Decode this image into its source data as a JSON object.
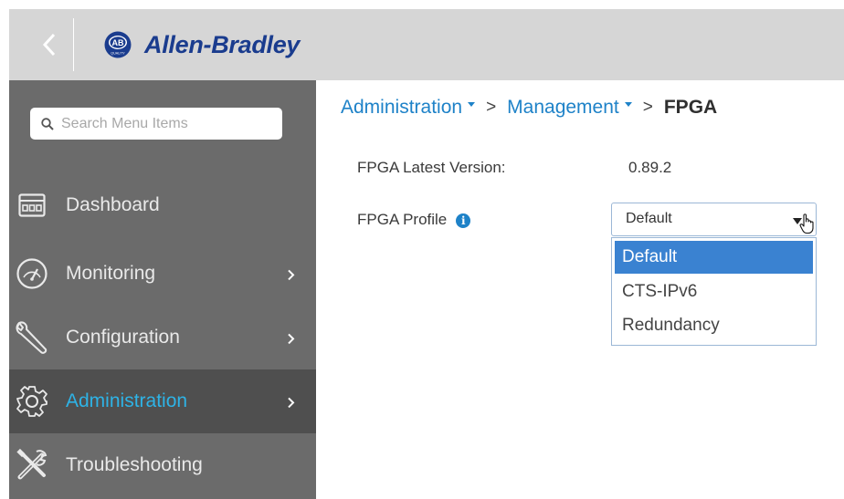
{
  "header": {
    "back_icon": "chevron-left-icon",
    "logo_badge": "AB",
    "logo_badge_sub": "QUALITY",
    "logo_text": "Allen-Bradley",
    "brand_color": "#1a3c8e"
  },
  "sidebar": {
    "search_placeholder": "Search Menu Items",
    "items": [
      {
        "label": "Dashboard",
        "icon": "dashboard-icon",
        "has_chevron": false,
        "active": false
      },
      {
        "label": "Monitoring",
        "icon": "gauge-icon",
        "has_chevron": true,
        "active": false
      },
      {
        "label": "Configuration",
        "icon": "wrench-icon",
        "has_chevron": true,
        "active": false
      },
      {
        "label": "Administration",
        "icon": "gear-icon",
        "has_chevron": true,
        "active": true
      },
      {
        "label": "Troubleshooting",
        "icon": "tools-icon",
        "has_chevron": false,
        "active": false
      }
    ],
    "active_color": "#2eb3e6"
  },
  "main": {
    "breadcrumb": {
      "items": [
        "Administration",
        "Management"
      ],
      "separator": ">",
      "current": "FPGA"
    },
    "fields": {
      "latest_version_label": "FPGA Latest Version:",
      "latest_version_value": "0.89.2",
      "profile_label": "FPGA Profile"
    },
    "profile_select": {
      "value": "Default",
      "options": [
        "Default",
        "CTS-IPv6",
        "Redundancy"
      ],
      "highlighted": "Default"
    },
    "link_color": "#1e82c8",
    "highlight_color": "#3a82d1"
  }
}
